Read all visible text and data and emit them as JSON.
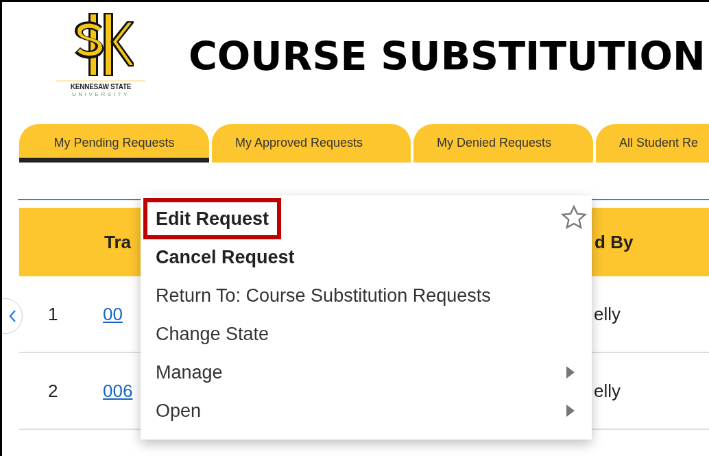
{
  "logo": {
    "name": "KENNESAW STATE",
    "subtitle": "UNIVERSITY"
  },
  "title": "COURSE SUBSTITUTION",
  "tabs": [
    {
      "label": "My Pending Requests",
      "selected": true
    },
    {
      "label": "My Approved Requests",
      "selected": false
    },
    {
      "label": "My Denied Requests",
      "selected": false
    },
    {
      "label": "All Student Re",
      "selected": false
    }
  ],
  "table": {
    "columns": [
      "Tra",
      "d By"
    ],
    "rows": [
      {
        "number": "1",
        "id": "00",
        "name": "elly"
      },
      {
        "number": "2",
        "id": "006",
        "name": "elly"
      }
    ]
  },
  "context_menu": {
    "favorite": false,
    "items": [
      {
        "label": "Edit Request",
        "bold": true,
        "highlighted": true,
        "submenu": false
      },
      {
        "label": "Cancel Request",
        "bold": true,
        "highlighted": false,
        "submenu": false
      },
      {
        "label": "Return To: Course Substitution Requests",
        "bold": false,
        "highlighted": false,
        "submenu": false
      },
      {
        "label": "Change State",
        "bold": false,
        "highlighted": false,
        "submenu": false
      },
      {
        "label": "Manage",
        "bold": false,
        "highlighted": false,
        "submenu": true
      },
      {
        "label": "Open",
        "bold": false,
        "highlighted": false,
        "submenu": true
      }
    ]
  }
}
